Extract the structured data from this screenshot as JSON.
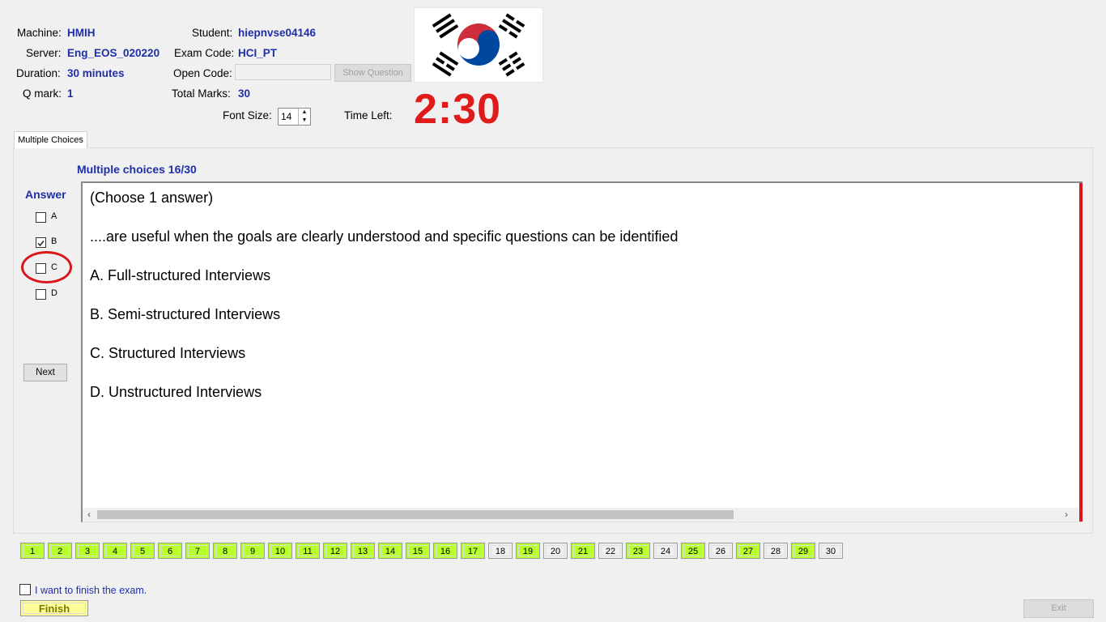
{
  "info": {
    "machine_label": "Machine:",
    "machine_value": "HMIH",
    "server_label": "Server:",
    "server_value": "Eng_EOS_020220",
    "duration_label": "Duration:",
    "duration_value": "30 minutes",
    "qmark_label": "Q mark:",
    "qmark_value": "1",
    "student_label": "Student:",
    "student_value": "hiepnvse04146",
    "examcode_label": "Exam Code:",
    "examcode_value": "HCI_PT",
    "opencode_label": "Open Code:",
    "opencode_value": "",
    "show_question_label": "Show Question",
    "totalmarks_label": "Total Marks:",
    "totalmarks_value": "30",
    "fontsize_label": "Font Size:",
    "fontsize_value": "14",
    "timeleft_label": "Time Left:",
    "timeleft_value": "2:30"
  },
  "flag_icon": "korean-flag",
  "tab_label": "Multiple Choices",
  "progress_label": "Multiple choices 16/30",
  "answer": {
    "title": "Answer",
    "options": [
      {
        "label": "A",
        "checked": false
      },
      {
        "label": "B",
        "checked": true
      },
      {
        "label": "C",
        "checked": false
      },
      {
        "label": "D",
        "checked": false
      }
    ],
    "next_label": "Next"
  },
  "question": {
    "instruction": "(Choose 1 answer)",
    "stem": "....are useful when the goals are clearly understood and specific questions can be identified",
    "choices": [
      "A.  Full-structured Interviews",
      "B.  Semi-structured Interviews",
      "C.  Structured Interviews",
      "D.  Unstructured Interviews"
    ]
  },
  "question_nav": {
    "numbers": [
      "1",
      "2",
      "3",
      "4",
      "5",
      "6",
      "7",
      "8",
      "9",
      "10",
      "11",
      "12",
      "13",
      "14",
      "15",
      "16",
      "17",
      "18",
      "19",
      "20",
      "21",
      "22",
      "23",
      "24",
      "25",
      "26",
      "27",
      "28",
      "29",
      "30"
    ],
    "answered": [
      true,
      true,
      true,
      true,
      true,
      true,
      true,
      true,
      true,
      true,
      true,
      true,
      true,
      true,
      true,
      true,
      true,
      false,
      true,
      false,
      true,
      false,
      true,
      false,
      true,
      false,
      true,
      false,
      true,
      false
    ]
  },
  "footer": {
    "finish_confirm_label": "I want to finish the exam.",
    "finish_label": "Finish",
    "exit_label": "Exit"
  },
  "colors": {
    "value_blue": "#1f2fa8",
    "timer_red": "#e01b1b",
    "answered_green": "#b7ff2a",
    "finish_yellow": "#ffff99"
  }
}
